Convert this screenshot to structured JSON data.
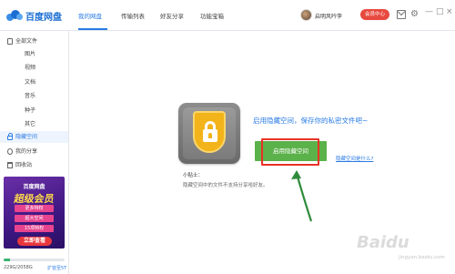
{
  "header": {
    "logo_text": "百度网盘",
    "tabs": [
      {
        "label": "我的网盘",
        "active": true
      },
      {
        "label": "传输列表",
        "active": false
      },
      {
        "label": "好友分享",
        "active": false
      },
      {
        "label": "功能宝箱",
        "active": false
      }
    ],
    "username": "启明风吟李",
    "vip_button": "会员中心",
    "window_controls": [
      "—",
      "□",
      "×"
    ]
  },
  "sidebar": {
    "items": [
      {
        "label": "全部文件",
        "icon": "folder-icon",
        "sub": false,
        "active": false
      },
      {
        "label": "图片",
        "sub": true,
        "active": false
      },
      {
        "label": "视频",
        "sub": true,
        "active": false
      },
      {
        "label": "文档",
        "sub": true,
        "active": false
      },
      {
        "label": "音乐",
        "sub": true,
        "active": false
      },
      {
        "label": "种子",
        "sub": true,
        "active": false
      },
      {
        "label": "其它",
        "sub": true,
        "active": false
      },
      {
        "label": "隐藏空间",
        "icon": "lock-icon",
        "sub": false,
        "active": true
      },
      {
        "label": "我的分享",
        "icon": "share-icon",
        "sub": false,
        "active": false
      },
      {
        "label": "回收站",
        "icon": "trash-icon",
        "sub": false,
        "active": false
      }
    ],
    "promo": {
      "brand": "百度网盘",
      "title": "超级会员",
      "lines": [
        "更多特权",
        "超大空间",
        "15项特权"
      ],
      "button": "立即查看"
    },
    "storage": {
      "text": "229G/2058G",
      "expand_link": "扩容至5T",
      "used_fraction": 0.11
    }
  },
  "main": {
    "headline": "启用隐藏空间，保存你的私密文件吧~",
    "enable_button": "启用隐藏空间",
    "what_link": "隐藏空间是什么?",
    "tip_title": "小贴士：",
    "tip_text": "隐藏空间中的文件不支持分享哈好友。"
  },
  "watermark": {
    "text": "Baidu",
    "sub": "jingyan.baidu.com"
  },
  "colors": {
    "accent": "#2a7be4",
    "button_green": "#5bb14a",
    "highlight_red": "#e83227",
    "vip_red": "#e8493f"
  }
}
